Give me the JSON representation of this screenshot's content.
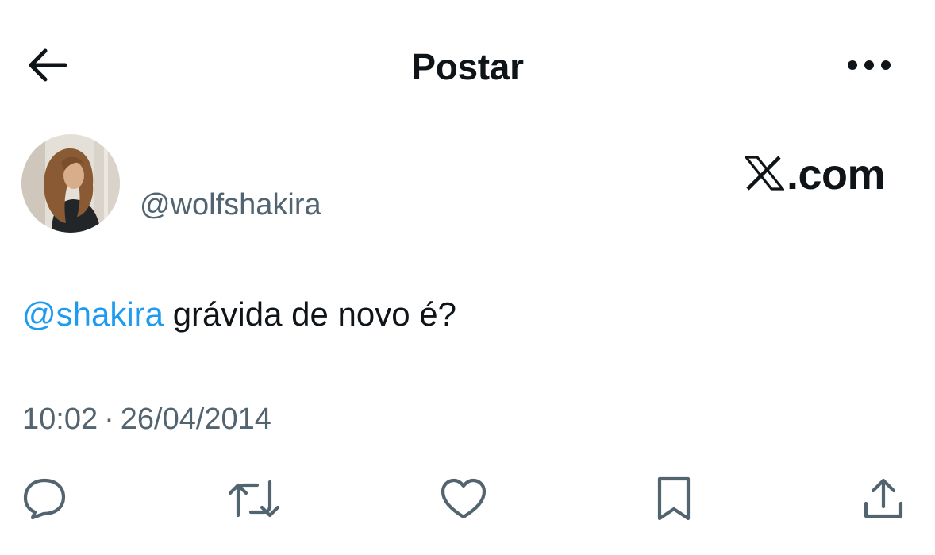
{
  "header": {
    "title": "Postar",
    "back_icon": "arrow-left-icon",
    "more_icon": "more-horizontal-icon"
  },
  "author": {
    "handle": "@wolfshakira",
    "avatar": "profile-photo"
  },
  "brand": {
    "logo_icon": "x-logo-icon",
    "text": ".com"
  },
  "post": {
    "mention": "@shakira",
    "text": " grávida de novo é?"
  },
  "meta": {
    "time": "10:02",
    "separator": "·",
    "date": "26/04/2014"
  },
  "actions": [
    {
      "icon": "reply-icon"
    },
    {
      "icon": "repost-icon"
    },
    {
      "icon": "like-icon"
    },
    {
      "icon": "bookmark-icon"
    },
    {
      "icon": "share-icon"
    }
  ],
  "colors": {
    "text": "#0f1419",
    "secondary": "#536471",
    "link": "#1d9bf0",
    "background": "#ffffff"
  }
}
